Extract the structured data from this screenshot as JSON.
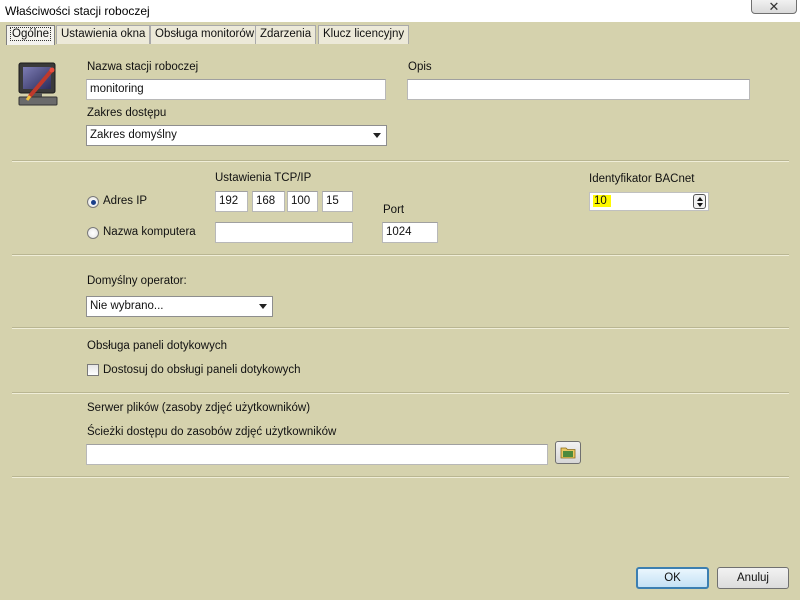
{
  "window": {
    "title": "Właściwości stacji roboczej",
    "close_symbol": "✕"
  },
  "tabs": [
    {
      "label": "Ogólne",
      "active": true
    },
    {
      "label": "Ustawienia okna",
      "active": false
    },
    {
      "label": "Obsługa monitorów",
      "active": false
    },
    {
      "label": "Zdarzenia",
      "active": false
    },
    {
      "label": "Klucz licencyjny",
      "active": false
    }
  ],
  "general": {
    "icon": "computer-pen-icon",
    "station_name_label": "Nazwa stacji roboczej",
    "station_name_value": "monitoring",
    "description_label": "Opis",
    "description_value": "",
    "access_scope_label": "Zakres dostępu",
    "access_scope_value": "Zakres domyślny"
  },
  "network": {
    "tcpip_label": "Ustawienia TCP/IP",
    "ip_option_label": "Adres IP",
    "ip_selected": true,
    "ip_octets": [
      "192",
      "168",
      "100",
      "15"
    ],
    "hostname_option_label": "Nazwa komputera",
    "hostname_value": "",
    "port_label": "Port",
    "port_value": "1024",
    "bacnet_label": "Identyfikator BACnet",
    "bacnet_value": "10",
    "bacnet_highlight": "#fffa00"
  },
  "operator": {
    "label": "Domyślny operator:",
    "value": "Nie wybrano..."
  },
  "touch": {
    "label": "Obsługa paneli dotykowych",
    "checkbox_label": "Dostosuj do obsługi paneli dotykowych",
    "checked": false
  },
  "file_server": {
    "label": "Serwer plików (zasoby zdjęć użytkowników)",
    "path_label": "Ścieżki dostępu do zasobów zdjęć użytkowników",
    "path_value": "",
    "browse_icon": "folder-icon"
  },
  "buttons": {
    "ok": "OK",
    "cancel": "Anuluj"
  },
  "colors": {
    "dialog_background": "#d5d2ad",
    "default_button_border": "#3c7fb1"
  }
}
